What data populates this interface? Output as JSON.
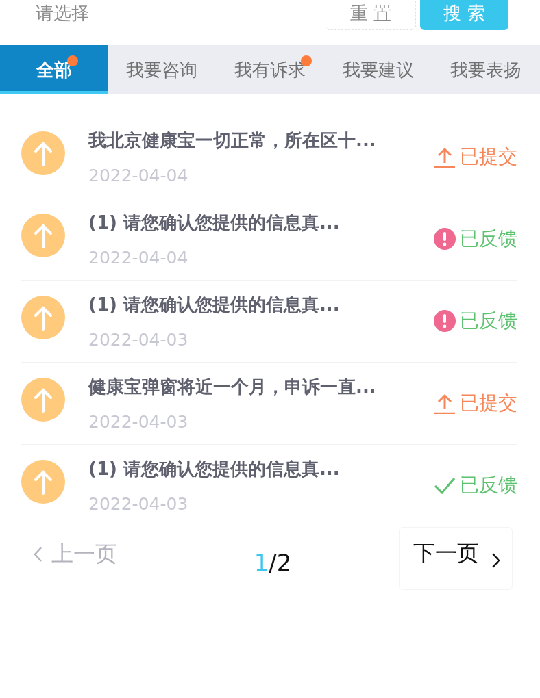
{
  "filter": {
    "placeholder": "请选择"
  },
  "buttons": [
    {
      "label": "重 置",
      "kind": "reset"
    },
    {
      "label": "搜 索",
      "kind": "search"
    }
  ],
  "tabs": [
    {
      "label": "全部",
      "selected": true,
      "badge": true
    },
    {
      "label": "我要咨询",
      "selected": false,
      "badge": false
    },
    {
      "label": "我有诉求",
      "selected": false,
      "badge": true
    },
    {
      "label": "我要建议",
      "selected": false,
      "badge": false
    },
    {
      "label": "我要表扬",
      "selected": false,
      "badge": false
    }
  ],
  "items": [
    {
      "title": "我北京健康宝一切正常，所在区十...",
      "date": "2022-04-04",
      "status": {
        "label": "已提交",
        "kind": "submitted"
      }
    },
    {
      "title": "(1) 请您确认您提供的信息真...",
      "date": "2022-04-04",
      "status": {
        "label": "已反馈",
        "kind": "alert"
      }
    },
    {
      "title": "(1) 请您确认您提供的信息真...",
      "date": "2022-04-03",
      "status": {
        "label": "已反馈",
        "kind": "alert"
      }
    },
    {
      "title": "健康宝弹窗将近一个月，申诉一直...",
      "date": "2022-04-03",
      "status": {
        "label": "已提交",
        "kind": "submitted"
      }
    },
    {
      "title": "(1) 请您确认您提供的信息真...",
      "date": "2022-04-03",
      "status": {
        "label": "已反馈",
        "kind": "done"
      }
    }
  ],
  "pagination": {
    "previous": {
      "label": "上一页",
      "disabled": true
    },
    "current_page": "1",
    "page_total": "/2",
    "next": {
      "label": "下一页",
      "disabled": false
    }
  }
}
